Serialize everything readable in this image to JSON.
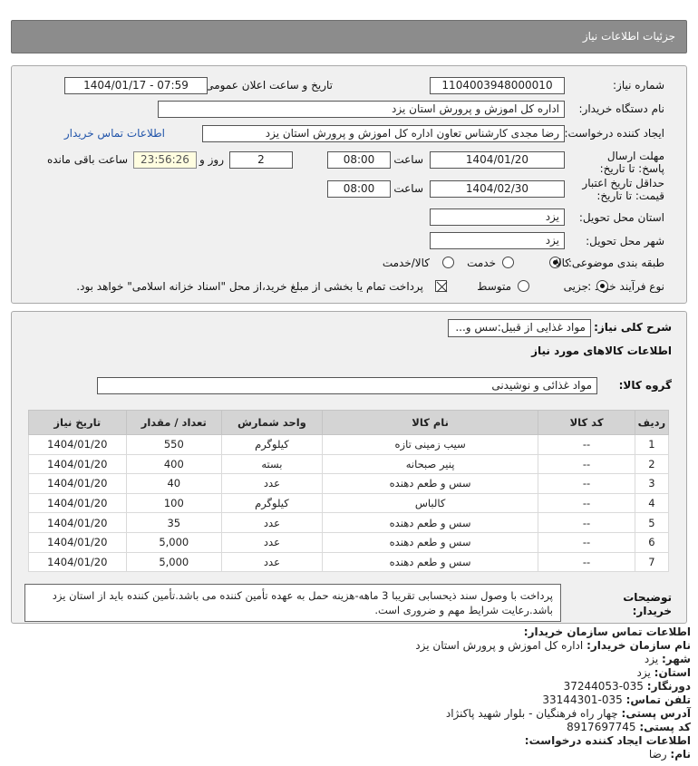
{
  "header": {
    "title": "جزئیات اطلاعات نیاز"
  },
  "form": {
    "need_number_label": "شماره نیاز:",
    "need_number": "1104003948000010",
    "announce_label": "تاریخ و ساعت اعلان عمومی:",
    "announce_value": "1404/01/17 - 07:59",
    "buyer_org_label": "نام دستگاه خریدار:",
    "buyer_org": "اداره کل اموزش و پرورش استان یزد",
    "creator_label": "ایجاد کننده درخواست:",
    "creator": "رضا مجدی کارشناس تعاون اداره کل اموزش و پرورش استان یزد",
    "buyer_contact_link": "اطلاعات تماس خریدار",
    "deadline_label": "مهلت ارسال پاسخ: تا تاریخ:",
    "deadline_date": "1404/01/20",
    "time_label": "ساعت",
    "deadline_time": "08:00",
    "days_value": "2",
    "days_label": "روز و",
    "remaining_time": "23:56:26",
    "remaining_label": "ساعت باقی مانده",
    "validity_label": "حداقل تاریخ اعتبار قیمت: تا تاریخ:",
    "validity_date": "1404/02/30",
    "validity_time": "08:00",
    "province_label": "استان محل تحویل:",
    "province": "یزد",
    "city_label": "شهر محل تحویل:",
    "city": "یزد",
    "category_label": "طبقه بندی موضوعی:",
    "category_options": [
      "کالا",
      "خدمت",
      "کالا/خدمت"
    ],
    "category_selected": "کالا",
    "process_label": "نوع فرآیند خرید :",
    "process_options": [
      "جزیی",
      "متوسط"
    ],
    "process_selected": "جزیی",
    "payment_note": "پرداخت تمام یا بخشی از مبلغ خرید،از محل \"اسناد خزانه اسلامی\" خواهد بود."
  },
  "details": {
    "general_desc_label": "شرح کلی نیاز:",
    "general_desc": "مواد غذایی از قبیل:سس و...",
    "goods_info_title": "اطلاعات کالاهای مورد نیاز",
    "goods_group_label": "گروه کالا:",
    "goods_group": "مواد غذائی و نوشیدنی",
    "table": {
      "headers": [
        "ردیف",
        "کد کالا",
        "نام کالا",
        "واحد شمارش",
        "تعداد / مقدار",
        "تاریخ نیاز"
      ],
      "rows": [
        [
          "1",
          "--",
          "سیب زمینی تازه",
          "کیلوگرم",
          "550",
          "1404/01/20"
        ],
        [
          "2",
          "--",
          "پنیر صبحانه",
          "بسته",
          "400",
          "1404/01/20"
        ],
        [
          "3",
          "--",
          "سس و طعم دهنده",
          "عدد",
          "40",
          "1404/01/20"
        ],
        [
          "4",
          "--",
          "کالباس",
          "کیلوگرم",
          "100",
          "1404/01/20"
        ],
        [
          "5",
          "--",
          "سس و طعم دهنده",
          "عدد",
          "35",
          "1404/01/20"
        ],
        [
          "6",
          "--",
          "سس و طعم دهنده",
          "عدد",
          "5,000",
          "1404/01/20"
        ],
        [
          "7",
          "--",
          "سس و طعم دهنده",
          "عدد",
          "5,000",
          "1404/01/20"
        ]
      ]
    },
    "buyer_notes_label": "توضیحات خریدار:",
    "buyer_notes": "پرداخت با وصول سند ذیحسابی تقریبا 3 ماهه-هزینه حمل به عهده تأمین کننده می باشد.تأمین کننده باید از استان یزد باشد.رعایت شرایط مهم و ضروری است."
  },
  "contact": {
    "section_title": "اطلاعات تماس سازمان خریدار:",
    "org_name_label": "نام سازمان خریدار:",
    "org_name": "اداره کل اموزش و پرورش استان یزد",
    "city_label": "شهر:",
    "city": "یزد",
    "province_label": "استان:",
    "province": "یزد",
    "fax_label": "دورنگار:",
    "fax": "035-37244053",
    "phone_label": "تلفن تماس:",
    "phone": "035-33144301",
    "address_label": "آدرس پستی:",
    "address": "چهار راه فرهنگیان - بلوار شهید پاکنژاد",
    "postal_label": "کد پستی:",
    "postal": "8917697745",
    "creator_section_title": "اطلاعات ایجاد کننده درخواست:",
    "first_name_label": "نام:",
    "first_name": "رضا"
  },
  "colors": {
    "header_bg": "#8c8c8c",
    "panel_bg": "#f0f0f0",
    "link": "#2255aa",
    "timer_bg": "#fffde0"
  }
}
